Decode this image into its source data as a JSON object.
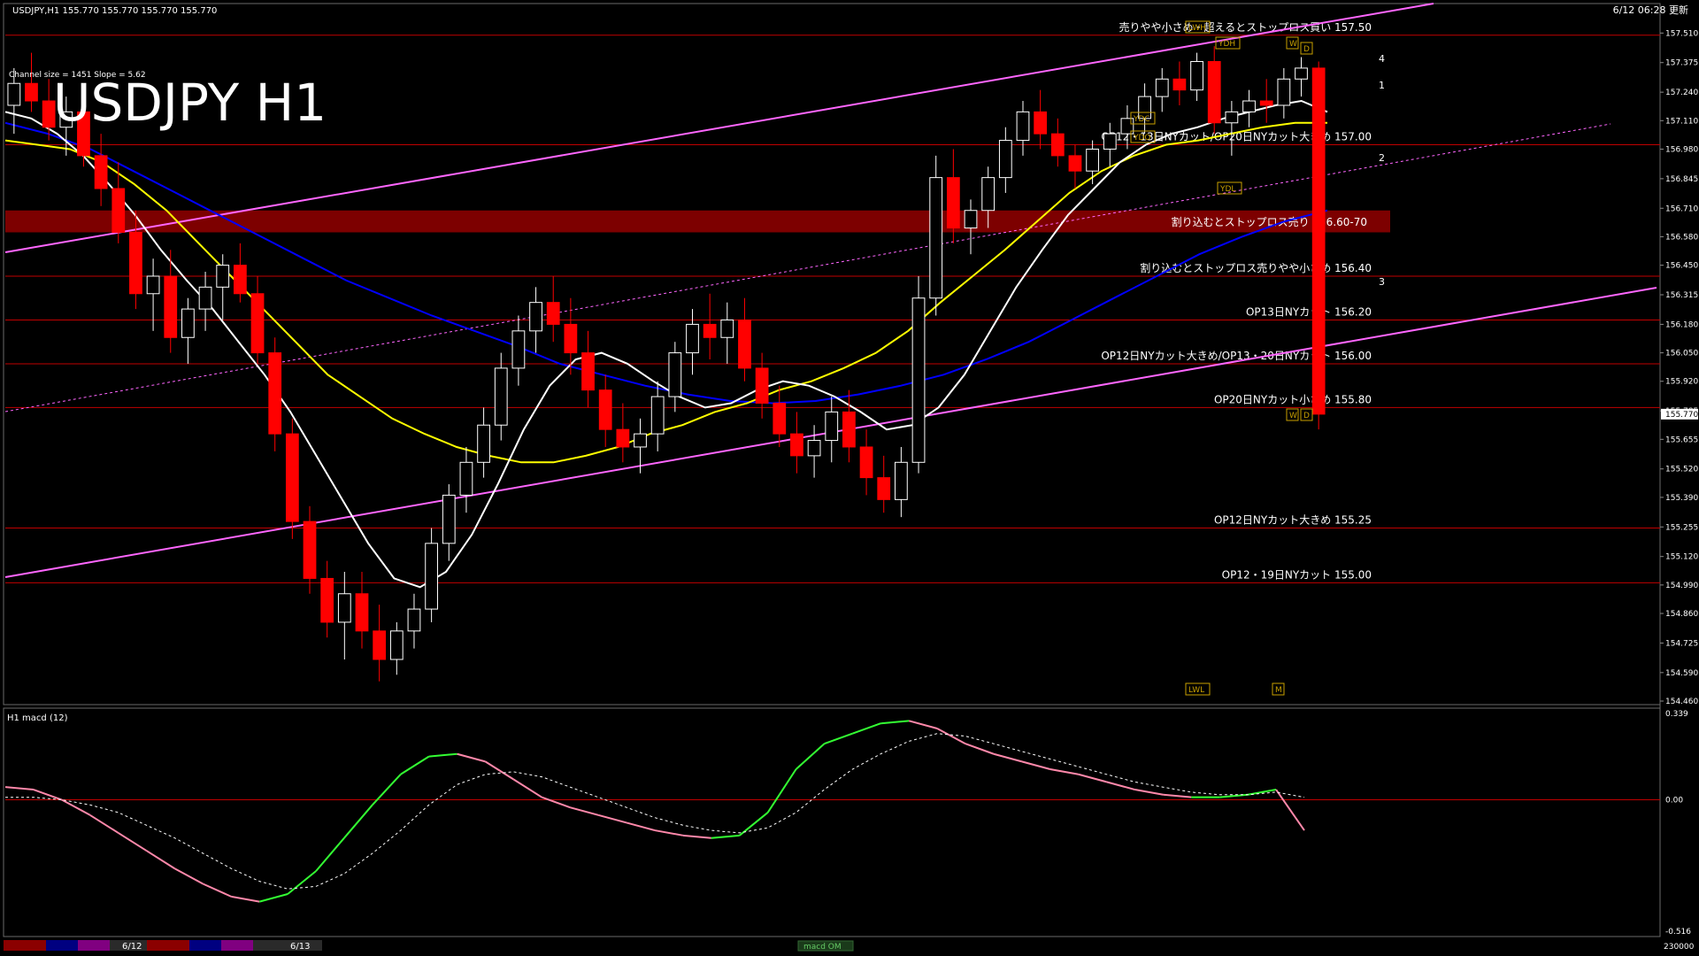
{
  "header": {
    "symbol_line": "USDJPY,H1  155.770 155.770 155.770 155.770",
    "clock": "6/12 06:28 更新",
    "watermark": "USDJPY H1",
    "channel_info": "Channel size = 1451 Slope = 5.62"
  },
  "colors": {
    "background": "#000000",
    "bull_candle": "#ffffff",
    "bear_candle": "#ff0000",
    "ma_fast": "#ffffff",
    "ma_mid": "#ffff00",
    "ma_slow": "#0000ff",
    "channel": "#ff66ff",
    "level_line": "#c00000",
    "zone_band": "#8b0000",
    "label_text": "#ffffff",
    "macd_up": "#33ff33",
    "macd_down": "#ff88aa"
  },
  "chart_data": [
    {
      "type": "candlestick",
      "title": "USDJPY H1",
      "ylim": [
        154.46,
        157.58
      ],
      "price_axis_ticks": [
        "157.510",
        "157.375",
        "157.240",
        "157.110",
        "156.980",
        "156.845",
        "156.710",
        "156.580",
        "156.450",
        "156.315",
        "156.180",
        "156.050",
        "155.920",
        "155.785",
        "155.655",
        "155.520",
        "155.390",
        "155.255",
        "155.120",
        "154.990",
        "154.860",
        "154.725",
        "154.590",
        "154.460"
      ],
      "current_price": 155.77,
      "current_price_label": "155.770",
      "levels": [
        {
          "price": 157.5,
          "label": "売りやや小さめ・超えるとストップロス買い 157.50"
        },
        {
          "price": 157.0,
          "label": "OP12・13日NYカット/OP20日NYカット大きめ 157.00"
        },
        {
          "price": 156.4,
          "label": "割り込むとストップロス売りやや小さめ 156.40"
        },
        {
          "price": 156.2,
          "label": "OP13日NYカット 156.20"
        },
        {
          "price": 156.0,
          "label": "OP12日NYカット大きめ/OP13・20日NYカット 156.00"
        },
        {
          "price": 155.8,
          "label": "OP20日NYカット小さめ 155.80"
        },
        {
          "price": 155.25,
          "label": "OP12日NYカット大きめ 155.25"
        },
        {
          "price": 155.0,
          "label": "OP12・19日NYカット 155.00"
        }
      ],
      "zone": {
        "high": 156.7,
        "low": 156.6,
        "label": "割り込むとストップロス売り 156.60-70"
      },
      "wave_labels": [
        "4",
        "1",
        "2",
        "3"
      ],
      "box_tags": [
        "LWH",
        "YDH",
        "W",
        "D",
        "YDC",
        "YDO",
        "YDL",
        "W",
        "D",
        "LWL",
        "M"
      ],
      "candles": [
        [
          157.18,
          157.35,
          157.05,
          157.28
        ],
        [
          157.28,
          157.42,
          157.15,
          157.2
        ],
        [
          157.2,
          157.3,
          157.02,
          157.08
        ],
        [
          157.08,
          157.22,
          156.95,
          157.15
        ],
        [
          157.15,
          157.25,
          156.9,
          156.95
        ],
        [
          156.95,
          157.05,
          156.72,
          156.8
        ],
        [
          156.8,
          156.92,
          156.55,
          156.6
        ],
        [
          156.6,
          156.7,
          156.25,
          156.32
        ],
        [
          156.32,
          156.48,
          156.15,
          156.4
        ],
        [
          156.4,
          156.52,
          156.05,
          156.12
        ],
        [
          156.12,
          156.3,
          156.0,
          156.25
        ],
        [
          156.25,
          156.42,
          156.15,
          156.35
        ],
        [
          156.35,
          156.5,
          156.2,
          156.45
        ],
        [
          156.45,
          156.55,
          156.28,
          156.32
        ],
        [
          156.32,
          156.4,
          156.0,
          156.05
        ],
        [
          156.05,
          156.12,
          155.6,
          155.68
        ],
        [
          155.68,
          155.75,
          155.2,
          155.28
        ],
        [
          155.28,
          155.35,
          154.95,
          155.02
        ],
        [
          155.02,
          155.1,
          154.75,
          154.82
        ],
        [
          154.82,
          155.05,
          154.65,
          154.95
        ],
        [
          154.95,
          155.05,
          154.7,
          154.78
        ],
        [
          154.78,
          154.9,
          154.55,
          154.65
        ],
        [
          154.65,
          154.82,
          154.58,
          154.78
        ],
        [
          154.78,
          154.95,
          154.7,
          154.88
        ],
        [
          154.88,
          155.25,
          154.82,
          155.18
        ],
        [
          155.18,
          155.45,
          155.1,
          155.4
        ],
        [
          155.4,
          155.62,
          155.32,
          155.55
        ],
        [
          155.55,
          155.8,
          155.48,
          155.72
        ],
        [
          155.72,
          156.05,
          155.65,
          155.98
        ],
        [
          155.98,
          156.22,
          155.9,
          156.15
        ],
        [
          156.15,
          156.35,
          156.05,
          156.28
        ],
        [
          156.28,
          156.4,
          156.1,
          156.18
        ],
        [
          156.18,
          156.3,
          155.95,
          156.05
        ],
        [
          156.05,
          156.15,
          155.8,
          155.88
        ],
        [
          155.88,
          155.95,
          155.62,
          155.7
        ],
        [
          155.7,
          155.82,
          155.55,
          155.62
        ],
        [
          155.62,
          155.75,
          155.5,
          155.68
        ],
        [
          155.68,
          155.92,
          155.6,
          155.85
        ],
        [
          155.85,
          156.1,
          155.78,
          156.05
        ],
        [
          156.05,
          156.25,
          155.95,
          156.18
        ],
        [
          156.18,
          156.32,
          156.02,
          156.12
        ],
        [
          156.12,
          156.28,
          156.0,
          156.2
        ],
        [
          156.2,
          156.3,
          155.92,
          155.98
        ],
        [
          155.98,
          156.05,
          155.75,
          155.82
        ],
        [
          155.82,
          155.9,
          155.62,
          155.68
        ],
        [
          155.68,
          155.78,
          155.5,
          155.58
        ],
        [
          155.58,
          155.72,
          155.48,
          155.65
        ],
        [
          155.65,
          155.85,
          155.55,
          155.78
        ],
        [
          155.78,
          155.88,
          155.55,
          155.62
        ],
        [
          155.62,
          155.7,
          155.4,
          155.48
        ],
        [
          155.48,
          155.58,
          155.32,
          155.38
        ],
        [
          155.38,
          155.62,
          155.3,
          155.55
        ],
        [
          155.55,
          156.4,
          155.5,
          156.3
        ],
        [
          156.3,
          156.95,
          156.22,
          156.85
        ],
        [
          156.85,
          156.98,
          156.55,
          156.62
        ],
        [
          156.62,
          156.75,
          156.5,
          156.7
        ],
        [
          156.7,
          156.9,
          156.62,
          156.85
        ],
        [
          156.85,
          157.08,
          156.78,
          157.02
        ],
        [
          157.02,
          157.2,
          156.95,
          157.15
        ],
        [
          157.15,
          157.25,
          156.98,
          157.05
        ],
        [
          157.05,
          157.12,
          156.9,
          156.95
        ],
        [
          156.95,
          157.0,
          156.8,
          156.88
        ],
        [
          156.88,
          157.02,
          156.82,
          156.98
        ],
        [
          156.98,
          157.1,
          156.9,
          157.05
        ],
        [
          157.05,
          157.18,
          156.98,
          157.12
        ],
        [
          157.12,
          157.28,
          157.05,
          157.22
        ],
        [
          157.22,
          157.35,
          157.15,
          157.3
        ],
        [
          157.3,
          157.38,
          157.18,
          157.25
        ],
        [
          157.25,
          157.42,
          157.2,
          157.38
        ],
        [
          157.38,
          157.45,
          157.05,
          157.1
        ],
        [
          157.1,
          157.2,
          156.95,
          157.15
        ],
        [
          157.15,
          157.25,
          157.08,
          157.2
        ],
        [
          157.2,
          157.3,
          157.1,
          157.18
        ],
        [
          157.18,
          157.35,
          157.12,
          157.3
        ],
        [
          157.3,
          157.4,
          157.22,
          157.35
        ],
        [
          157.35,
          157.38,
          155.7,
          155.77
        ]
      ],
      "ma_fast": [
        157.15,
        157.12,
        157.05,
        156.95,
        156.82,
        156.68,
        156.52,
        156.38,
        156.25,
        156.1,
        155.95,
        155.78,
        155.58,
        155.38,
        155.18,
        155.02,
        154.98,
        155.05,
        155.22,
        155.45,
        155.7,
        155.9,
        156.02,
        156.05,
        156.0,
        155.92,
        155.85,
        155.8,
        155.82,
        155.88,
        155.92,
        155.9,
        155.85,
        155.78,
        155.7,
        155.72,
        155.8,
        155.95,
        156.15,
        156.35,
        156.52,
        156.68,
        156.8,
        156.92,
        157.0,
        157.05,
        157.08,
        157.12,
        157.15,
        157.18,
        157.2,
        157.15
      ],
      "ma_mid": [
        157.02,
        157.0,
        156.98,
        156.92,
        156.82,
        156.7,
        156.55,
        156.4,
        156.25,
        156.1,
        155.95,
        155.85,
        155.75,
        155.68,
        155.62,
        155.58,
        155.55,
        155.55,
        155.58,
        155.62,
        155.68,
        155.72,
        155.78,
        155.82,
        155.88,
        155.92,
        155.98,
        156.05,
        156.15,
        156.28,
        156.4,
        156.52,
        156.65,
        156.78,
        156.88,
        156.95,
        157.0,
        157.02,
        157.05,
        157.08,
        157.1,
        157.1
      ],
      "ma_slow": [
        157.1,
        157.05,
        156.98,
        156.88,
        156.78,
        156.68,
        156.58,
        156.48,
        156.38,
        156.3,
        156.22,
        156.15,
        156.08,
        156.0,
        155.95,
        155.9,
        155.86,
        155.83,
        155.82,
        155.83,
        155.86,
        155.9,
        155.95,
        156.02,
        156.1,
        156.2,
        156.3,
        156.4,
        156.5,
        156.58,
        156.65,
        156.7
      ]
    },
    {
      "type": "line",
      "title": "H1  macd (12)",
      "ylim": [
        -0.516,
        0.339
      ],
      "axis_ticks": [
        "0.339",
        "0.00",
        "-0.516"
      ],
      "series": [
        {
          "values": [
            0.05,
            0.04,
            0.0,
            -0.06,
            -0.13,
            -0.2,
            -0.27,
            -0.33,
            -0.38,
            -0.4,
            -0.37,
            -0.28,
            -0.15,
            -0.02,
            0.1,
            0.17,
            0.18,
            0.15,
            0.08,
            0.01,
            -0.03,
            -0.06,
            -0.09,
            -0.12,
            -0.14,
            -0.15,
            -0.14,
            -0.05,
            0.12,
            0.22,
            0.26,
            0.3,
            0.31,
            0.28,
            0.22,
            0.18,
            0.15,
            0.12,
            0.1,
            0.07,
            0.04,
            0.02,
            0.01,
            0.01,
            0.02,
            0.04,
            -0.12
          ]
        },
        {
          "values": [
            0.01,
            0.01,
            0.0,
            -0.02,
            -0.05,
            -0.1,
            -0.15,
            -0.21,
            -0.27,
            -0.32,
            -0.35,
            -0.34,
            -0.29,
            -0.21,
            -0.12,
            -0.02,
            0.06,
            0.1,
            0.11,
            0.09,
            0.05,
            0.01,
            -0.03,
            -0.07,
            -0.1,
            -0.12,
            -0.13,
            -0.11,
            -0.05,
            0.04,
            0.12,
            0.18,
            0.23,
            0.26,
            0.25,
            0.22,
            0.19,
            0.16,
            0.13,
            0.1,
            0.07,
            0.05,
            0.03,
            0.02,
            0.02,
            0.03,
            0.01
          ]
        }
      ]
    }
  ],
  "footer": {
    "dates": [
      "6/12",
      "6/13"
    ],
    "indicator_tag": "macd OM",
    "volume_label": "230000"
  }
}
